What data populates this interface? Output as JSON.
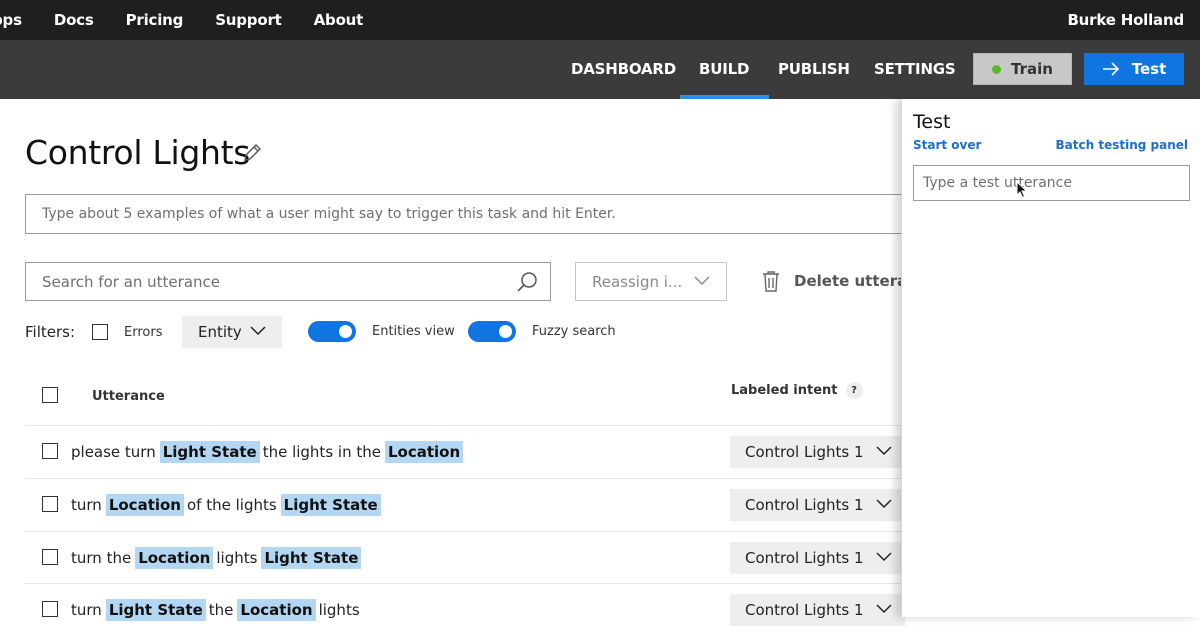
{
  "topnav": {
    "items": [
      "pps",
      "Docs",
      "Pricing",
      "Support",
      "About"
    ],
    "user": "Burke Holland"
  },
  "appnav": {
    "tabs": [
      "DASHBOARD",
      "BUILD",
      "PUBLISH",
      "SETTINGS"
    ],
    "active_tab": "BUILD",
    "train_label": "Train",
    "test_label": "Test"
  },
  "main": {
    "title": "Control Lights",
    "examples_placeholder": "Type about 5 examples of what a user might say to trigger this task and hit Enter.",
    "search_placeholder": "Search for an utterance",
    "reassign_label": "Reassign i...",
    "delete_label": "Delete utteran",
    "filters": {
      "label": "Filters:",
      "errors_label": "Errors",
      "entity_label": "Entity",
      "entities_view_label": "Entities view",
      "fuzzy_search_label": "Fuzzy search"
    },
    "table": {
      "col_utterance": "Utterance",
      "col_intent": "Labeled intent",
      "help_glyph": "?",
      "rows": [
        {
          "tokens": [
            {
              "t": "please turn",
              "e": false
            },
            {
              "t": "Light State",
              "e": true
            },
            {
              "t": "the lights in the",
              "e": false
            },
            {
              "t": "Location",
              "e": true
            }
          ],
          "intent": "Control Lights 1"
        },
        {
          "tokens": [
            {
              "t": "turn",
              "e": false
            },
            {
              "t": "Location",
              "e": true
            },
            {
              "t": "of the lights",
              "e": false
            },
            {
              "t": "Light State",
              "e": true
            }
          ],
          "intent": "Control Lights 1"
        },
        {
          "tokens": [
            {
              "t": "turn the",
              "e": false
            },
            {
              "t": "Location",
              "e": true
            },
            {
              "t": "lights",
              "e": false
            },
            {
              "t": "Light State",
              "e": true
            }
          ],
          "intent": "Control Lights 1"
        },
        {
          "tokens": [
            {
              "t": "turn",
              "e": false
            },
            {
              "t": "Light State",
              "e": true
            },
            {
              "t": "the",
              "e": false
            },
            {
              "t": "Location",
              "e": true
            },
            {
              "t": "lights",
              "e": false
            }
          ],
          "intent": "Control Lights 1"
        }
      ]
    }
  },
  "test_panel": {
    "title": "Test",
    "start_over": "Start over",
    "batch_testing": "Batch testing panel",
    "input_placeholder": "Type a test utterance"
  },
  "colors": {
    "accent": "#0f75e0",
    "entity_highlight": "#b3d7f2",
    "train_status": "#5cb82e"
  }
}
